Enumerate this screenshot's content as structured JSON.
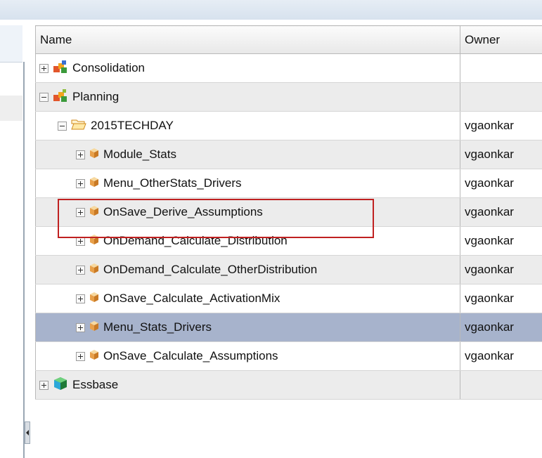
{
  "columns": {
    "name": "Name",
    "owner": "Owner"
  },
  "rows": [
    {
      "label": "Consolidation",
      "owner": "",
      "level": 0,
      "expander": "plus",
      "icon": "consolidation-app-icon"
    },
    {
      "label": "Planning",
      "owner": "",
      "level": 0,
      "expander": "minus",
      "icon": "planning-app-icon"
    },
    {
      "label": "2015TECHDAY",
      "owner": "vgaonkar",
      "level": 1,
      "expander": "minus",
      "icon": "open-folder-icon"
    },
    {
      "label": "Module_Stats",
      "owner": "vgaonkar",
      "level": 2,
      "expander": "plus",
      "icon": "rule-cube-icon"
    },
    {
      "label": "Menu_OtherStats_Drivers",
      "owner": "vgaonkar",
      "level": 2,
      "expander": "plus",
      "icon": "rule-cube-icon"
    },
    {
      "label": "OnSave_Derive_Assumptions",
      "owner": "vgaonkar",
      "level": 2,
      "expander": "plus",
      "icon": "rule-cube-icon"
    },
    {
      "label": "OnDemand_Calculate_Distribution",
      "owner": "vgaonkar",
      "level": 2,
      "expander": "plus",
      "icon": "rule-cube-icon"
    },
    {
      "label": "OnDemand_Calculate_OtherDistribution",
      "owner": "vgaonkar",
      "level": 2,
      "expander": "plus",
      "icon": "rule-cube-icon"
    },
    {
      "label": "OnSave_Calculate_ActivationMix",
      "owner": "vgaonkar",
      "level": 2,
      "expander": "plus",
      "icon": "rule-cube-icon"
    },
    {
      "label": "Menu_Stats_Drivers",
      "owner": "vgaonkar",
      "level": 2,
      "expander": "plus",
      "icon": "rule-cube-icon"
    },
    {
      "label": "OnSave_Calculate_Assumptions",
      "owner": "vgaonkar",
      "level": 2,
      "expander": "plus",
      "icon": "rule-cube-icon"
    },
    {
      "label": "Essbase",
      "owner": "",
      "level": 0,
      "expander": "plus",
      "icon": "essbase-app-icon"
    }
  ],
  "selected_row": "Menu_Stats_Drivers",
  "highlighted_row": "OnSave_Derive_Assumptions",
  "colors": {
    "selected": "#a7b3cc",
    "alt_row": "#ececec",
    "highlight_box": "#c02020"
  }
}
